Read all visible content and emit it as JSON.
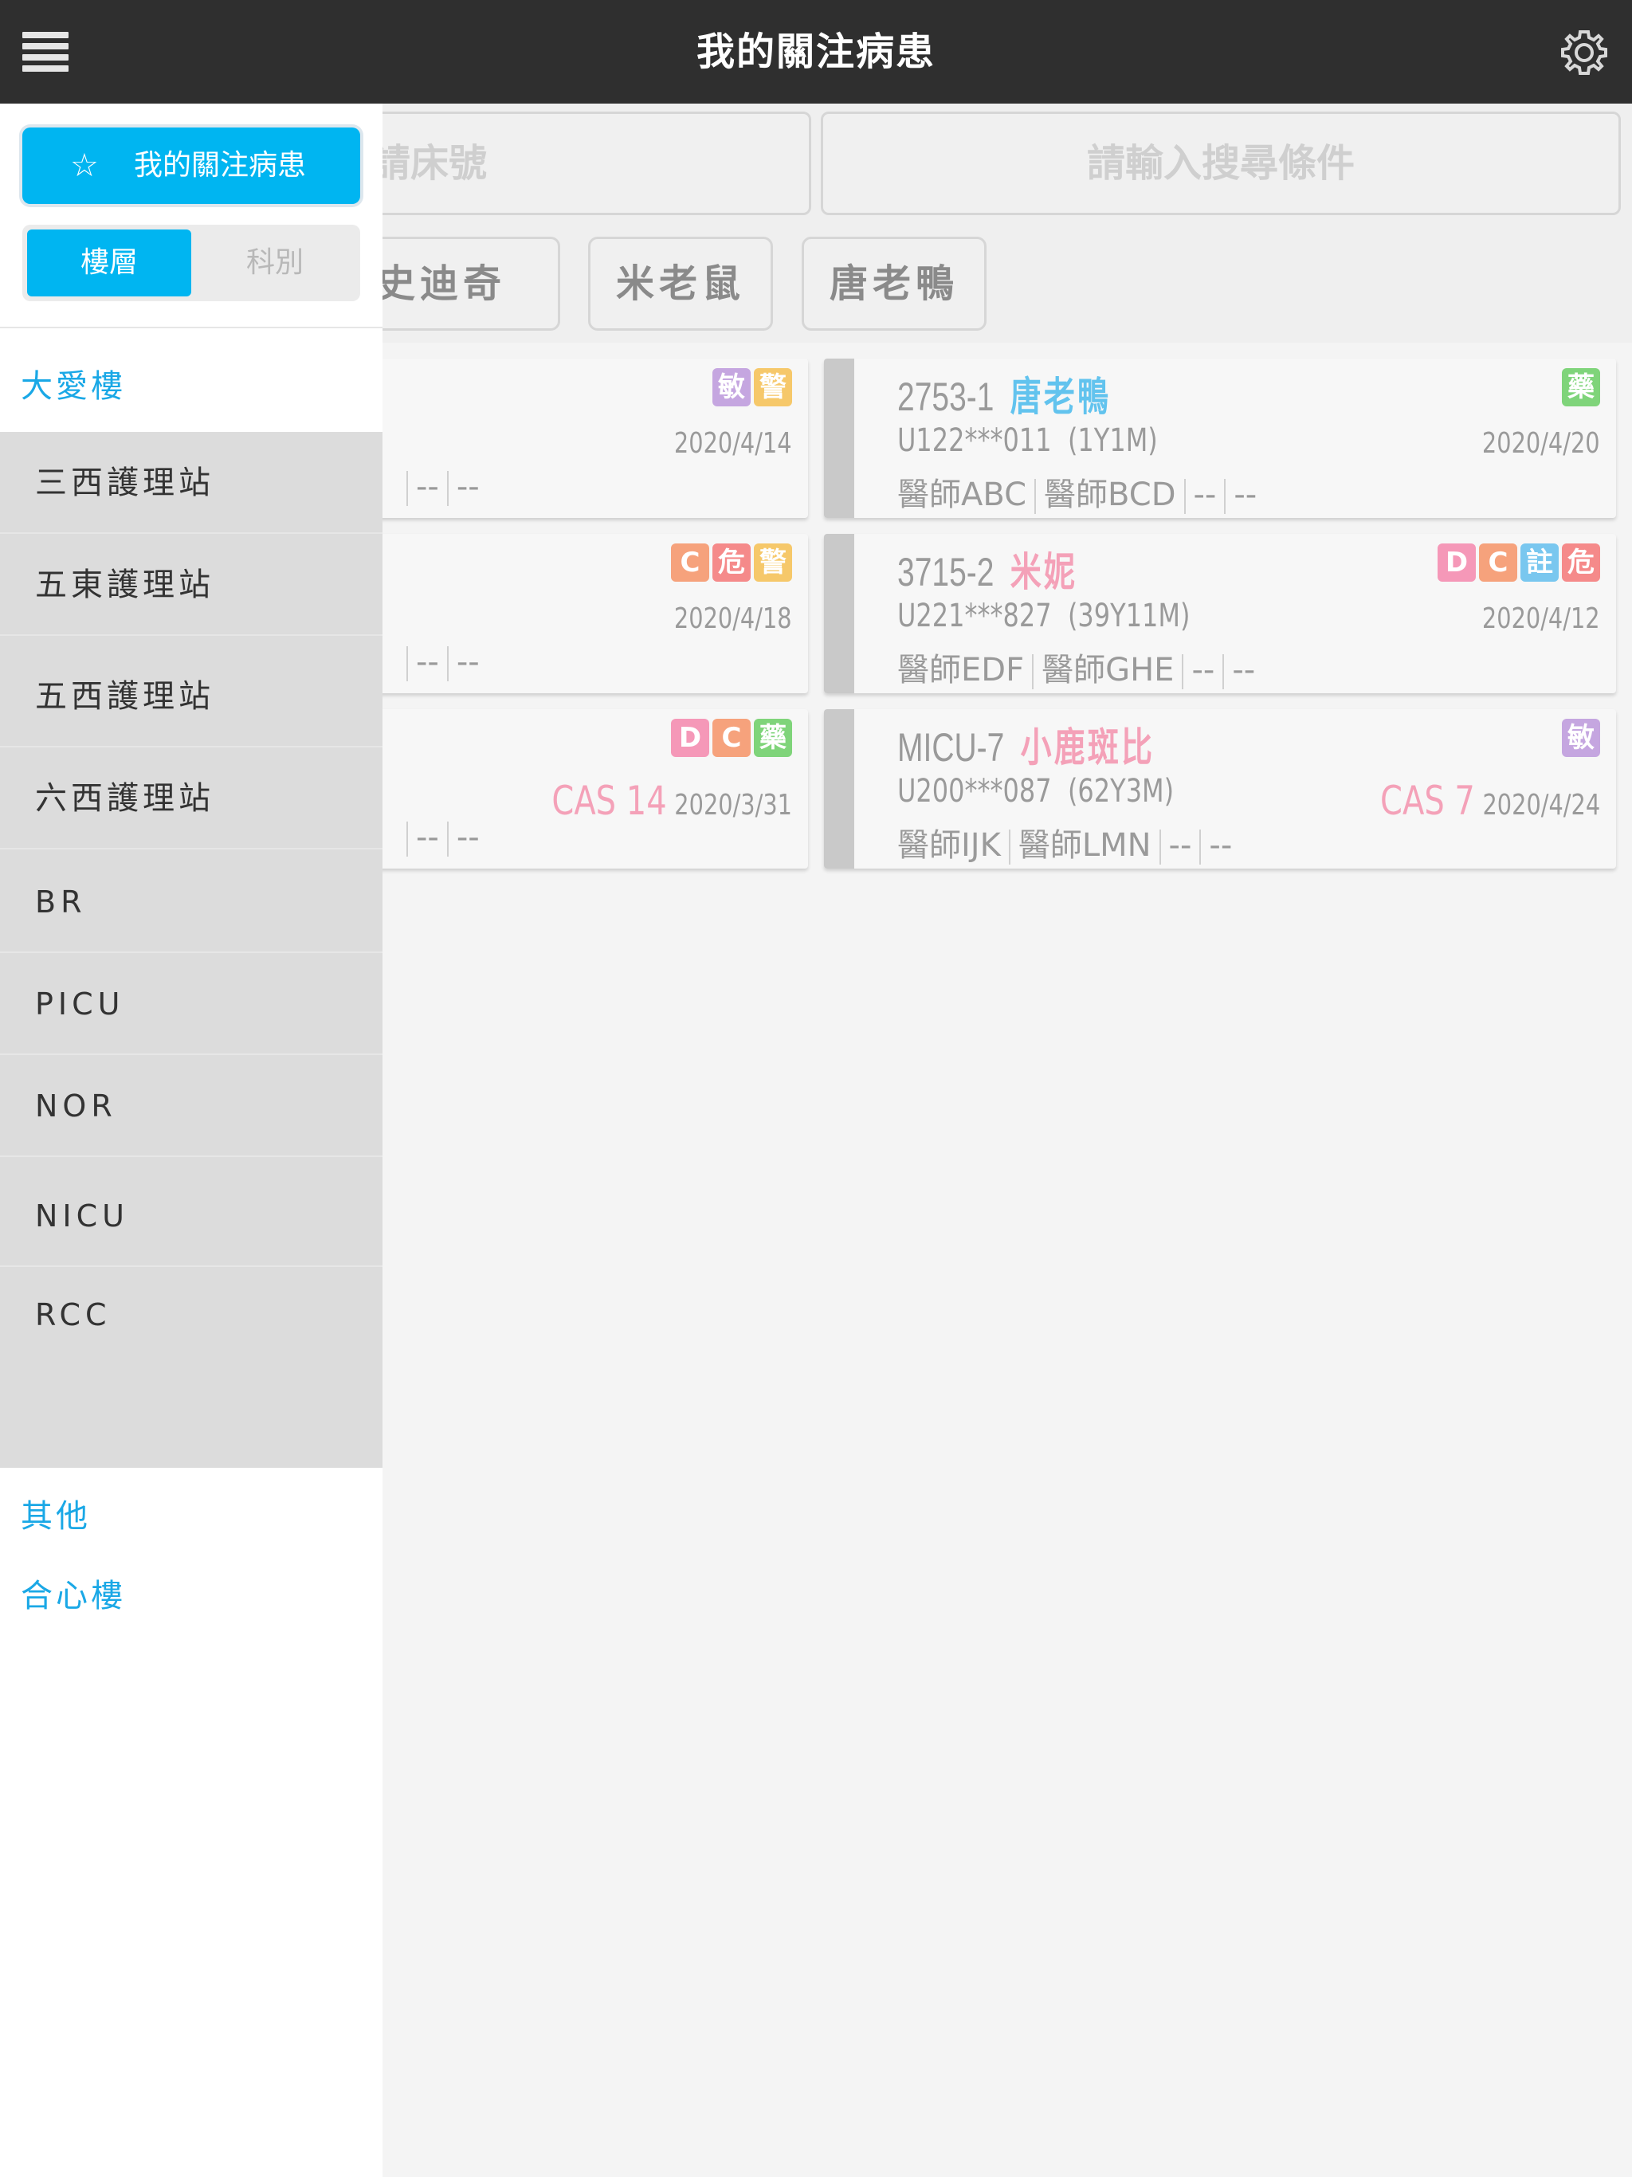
{
  "header": {
    "title": "我的關注病患",
    "menu_icon": "list-icon",
    "settings_icon": "gear-icon"
  },
  "search": {
    "bed_partial": "請床號",
    "condition_placeholder": "請輸入搜尋條件"
  },
  "chips": [
    "史迪奇",
    "米老鼠",
    "唐老鴨"
  ],
  "cards": [
    {
      "bed": "",
      "name": "",
      "id": "",
      "doctors": [
        "",
        "",
        "--",
        "--"
      ],
      "date": "2020/4/14",
      "cas": "",
      "tags": [
        "敏",
        "警"
      ]
    },
    {
      "bed": "2753-1",
      "name": "唐老鴨",
      "name_color": "#62c3ee",
      "id": "U122***011",
      "age": "(1Y1M)",
      "doctors": [
        "醫師ABC",
        "醫師BCD",
        "--",
        "--"
      ],
      "date": "2020/4/20",
      "cas": "",
      "tags": [
        "藥"
      ]
    },
    {
      "bed": "",
      "name": "",
      "id": "",
      "doctors": [
        "",
        "",
        "--",
        "--"
      ],
      "date": "2020/4/18",
      "cas": "",
      "tags": [
        "C",
        "危",
        "警"
      ]
    },
    {
      "bed": "3715-2",
      "name": "米妮",
      "name_color": "#f4a1b8",
      "id": "U221***827",
      "age": "(39Y11M)",
      "doctors": [
        "醫師EDF",
        "醫師GHE",
        "--",
        "--"
      ],
      "date": "2020/4/12",
      "cas": "",
      "tags": [
        "D",
        "C",
        "註",
        "危"
      ]
    },
    {
      "bed": "",
      "name": "",
      "id": "",
      "doctors": [
        "",
        "",
        "--",
        "--"
      ],
      "date": "2020/3/31",
      "cas": "CAS 14",
      "tags": [
        "D",
        "C",
        "藥"
      ]
    },
    {
      "bed": "MICU-7",
      "name": "小鹿斑比",
      "name_color": "#f4a1b8",
      "id": "U200***087",
      "age": "(62Y3M)",
      "doctors": [
        "醫師IJK",
        "醫師LMN",
        "--",
        "--"
      ],
      "date": "2020/4/24",
      "cas": "CAS 7",
      "tags": [
        "敏"
      ]
    }
  ],
  "tag_colors": {
    "敏": "#c5a6e0",
    "警": "#f6c86a",
    "藥": "#7fd47a",
    "C": "#f6a27c",
    "危": "#f58a8a",
    "D": "#f598b8",
    "註": "#79c7ef"
  },
  "drawer": {
    "fav_label": "我的關注病患",
    "seg_floor": "樓層",
    "seg_dept": "科別",
    "group_daai": "大愛樓",
    "stations": [
      "三西護理站",
      "五東護理站",
      "五西護理站",
      "六西護理站",
      "BR",
      "PICU",
      "NOR",
      "NICU",
      "RCC"
    ],
    "group_other": "其他",
    "group_hexin": "合心樓"
  }
}
